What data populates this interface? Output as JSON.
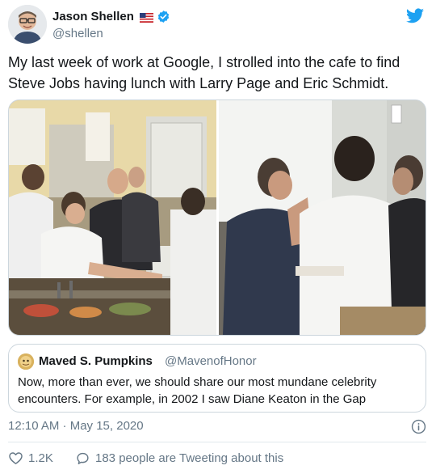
{
  "author": {
    "name": "Jason Shellen",
    "handle": "@shellen",
    "flag_icon": "us-flag-icon",
    "verified_icon": "verified-badge-icon"
  },
  "brand": {
    "icon": "twitter-bird-icon",
    "color": "#1da1f2"
  },
  "tweet": {
    "text": "My last week of work at Google, I strolled into the cafe to find Steve Jobs having lunch with Larry Page and Eric Schmidt."
  },
  "quoted_tweet": {
    "name": "Maved S. Pumpkins",
    "handle": "@MavenofHonor",
    "text": "Now, more than ever, we should share our most mundane celebrity encounters. For example, in 2002 I saw Diane Keaton in the Gap"
  },
  "meta": {
    "timestamp": "12:10 AM · May 15, 2020",
    "info_icon": "info-icon"
  },
  "actions": {
    "likes": "1.2K",
    "like_icon": "heart-icon",
    "conversation": "183 people are Tweeting about this",
    "conversation_icon": "speech-bubble-icon"
  },
  "colors": {
    "text": "#14171a",
    "secondary": "#657786",
    "border": "#ccd6dd"
  }
}
